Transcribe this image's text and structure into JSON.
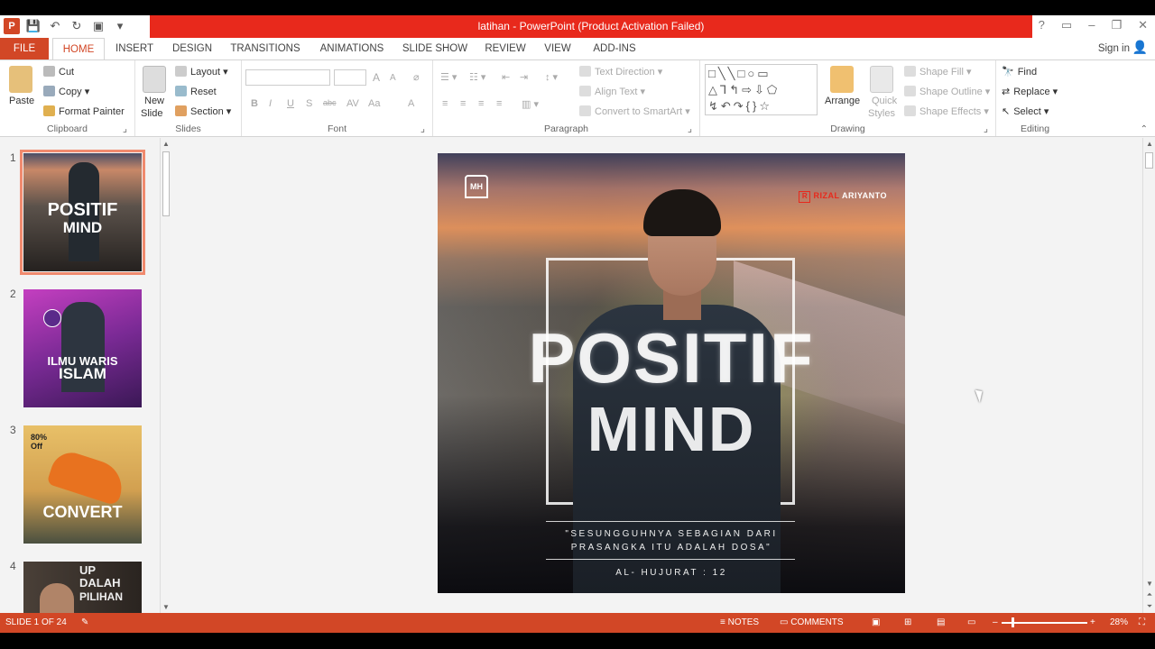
{
  "window": {
    "title": "latihan - PowerPoint (Product Activation Failed)",
    "controls": [
      "?",
      "▭",
      "–",
      "❐",
      "✕"
    ]
  },
  "ribbon_tabs": [
    "FILE",
    "HOME",
    "INSERT",
    "DESIGN",
    "TRANSITIONS",
    "ANIMATIONS",
    "SLIDE SHOW",
    "REVIEW",
    "VIEW",
    "ADD-INS"
  ],
  "signin": "Sign in",
  "clipboard": {
    "paste": "Paste",
    "cut": "Cut",
    "copy": "Copy",
    "format_painter": "Format Painter",
    "label": "Clipboard"
  },
  "slides_group": {
    "new_slide_1": "New",
    "new_slide_2": "Slide",
    "layout": "Layout",
    "reset": "Reset",
    "section": "Section",
    "label": "Slides"
  },
  "font_group": {
    "label": "Font",
    "bold": "B",
    "italic": "I",
    "underline": "U",
    "shadow": "S",
    "strike": "abc",
    "aa": "Aa",
    "font_color": "A",
    "grow": "A",
    "shrink": "A"
  },
  "paragraph_group": {
    "text_direction": "Text Direction",
    "align_text": "Align Text",
    "convert": "Convert to SmartArt",
    "label": "Paragraph"
  },
  "drawing_group": {
    "shapes_glyphs": "□╲╲□○▭\n△⅂↰⇨⇩⬠\n↯↶↷{}☆",
    "arrange": "Arrange",
    "quick_styles_1": "Quick",
    "quick_styles_2": "Styles",
    "shape_fill": "Shape Fill",
    "shape_outline": "Shape Outline",
    "shape_effects": "Shape Effects",
    "label": "Drawing"
  },
  "editing_group": {
    "find": "Find",
    "replace": "Replace",
    "select": "Select",
    "label": "Editing"
  },
  "thumbnails": [
    {
      "num": "1",
      "title_1": "POSITIF",
      "title_2": "MIND"
    },
    {
      "num": "2",
      "title_1": "ILMU WARIS",
      "title_2": "ISLAM"
    },
    {
      "num": "3",
      "title_1": "CONVERT",
      "badge": "80%\nOff"
    },
    {
      "num": "4",
      "title_1": "UP",
      "title_2": "DALAH",
      "title_3": "PILIHAN"
    }
  ],
  "slide": {
    "logo": "MH",
    "brand_first": "RIZAL",
    "brand_last": "ARIYANTO",
    "title_1": "POSITIF",
    "title_2": "MIND",
    "quote_1": "\"SESUNGGUHNYA SEBAGIAN DARI",
    "quote_2": "PRASANGKA ITU ADALAH DOSA\"",
    "source": "AL- HUJURAT : 12"
  },
  "status": {
    "slide_counter": "SLIDE 1 OF 24",
    "notes": "NOTES",
    "comments": "COMMENTS",
    "zoom": "28%"
  },
  "colors": {
    "accent": "#d24726",
    "title_red": "#e8291c"
  }
}
